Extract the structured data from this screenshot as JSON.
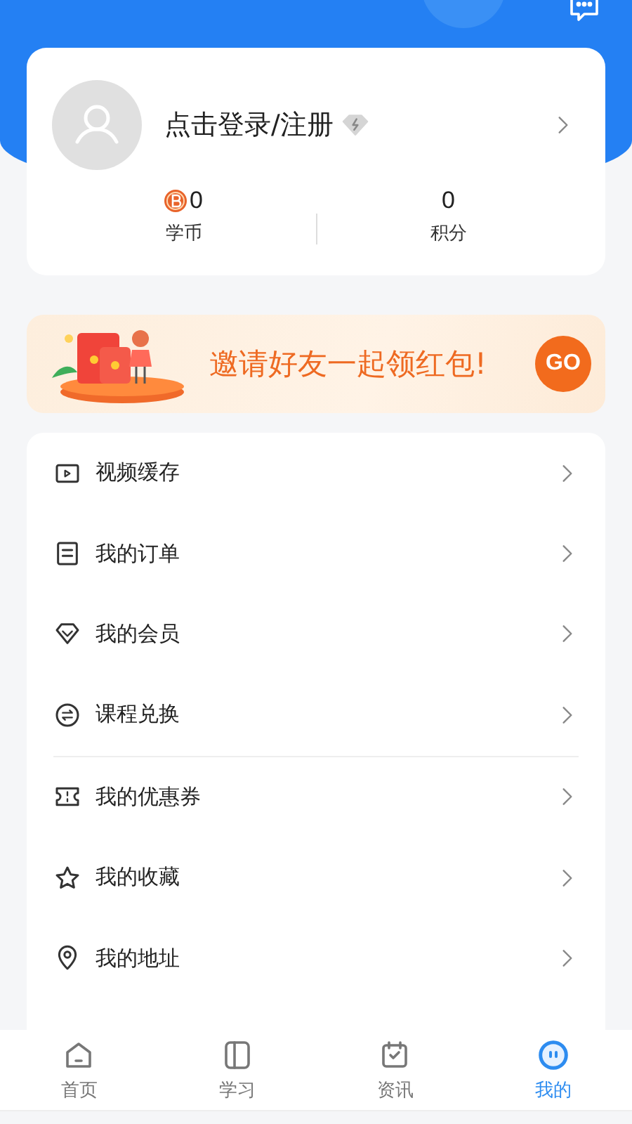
{
  "profile": {
    "login_text": "点击登录/注册",
    "stats": [
      {
        "kind": "coin",
        "value": "0",
        "label": "学币"
      },
      {
        "kind": "plain",
        "value": "0",
        "label": "积分"
      }
    ]
  },
  "banner": {
    "text": "邀请好友一起领红包!",
    "button": "GO"
  },
  "menu_sections": [
    {
      "items": [
        {
          "kind": "video",
          "label": "视频缓存"
        },
        {
          "kind": "order",
          "label": "我的订单"
        },
        {
          "kind": "member",
          "label": "我的会员"
        },
        {
          "kind": "exchange",
          "label": "课程兑换"
        }
      ]
    },
    {
      "items": [
        {
          "kind": "coupon",
          "label": "我的优惠券"
        },
        {
          "kind": "star",
          "label": "我的收藏"
        },
        {
          "kind": "location",
          "label": "我的地址"
        }
      ]
    }
  ],
  "tab_bar": [
    {
      "kind": "home",
      "label": "首页",
      "selected": false
    },
    {
      "kind": "study",
      "label": "学习",
      "selected": false
    },
    {
      "kind": "news",
      "label": "资讯",
      "selected": false
    },
    {
      "kind": "me",
      "label": "我的",
      "selected": true
    }
  ]
}
